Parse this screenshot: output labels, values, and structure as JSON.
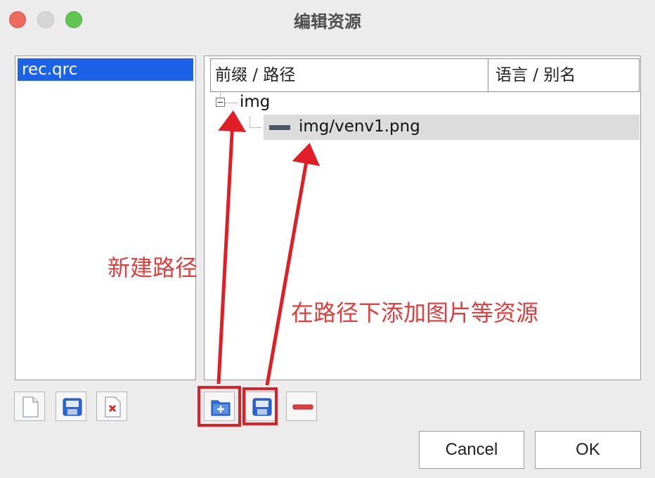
{
  "window": {
    "title": "编辑资源"
  },
  "left_list": {
    "items": [
      "rec.qrc"
    ]
  },
  "tree": {
    "columns": [
      "前缀 / 路径",
      "语言 / 别名"
    ],
    "prefix": "img",
    "file": "img/venv1.png"
  },
  "annotations": {
    "new_path": "新建路径",
    "add_resources": "在路径下添加图片等资源"
  },
  "buttons": {
    "cancel": "Cancel",
    "ok": "OK"
  },
  "colors": {
    "selection": "#1c62e8",
    "annotation": "#e01e25"
  }
}
